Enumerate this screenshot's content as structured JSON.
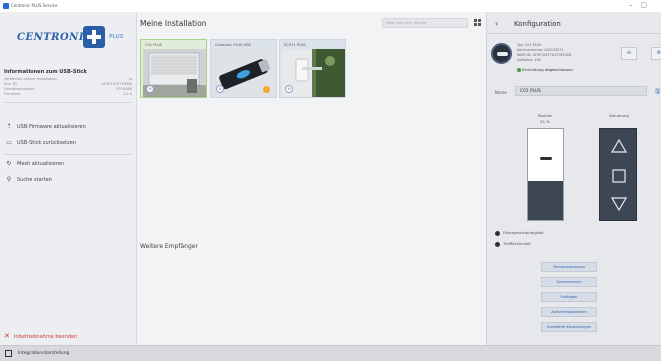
{
  "window": {
    "title": "Centronic PLUS Service"
  },
  "sidebar": {
    "logo": {
      "brand": "CENTRONIC",
      "plus_label": "PLUS"
    },
    "info_title": "Informationen zum USB-Stick",
    "info_rows": [
      {
        "label": "Verbindun aktiver Installation",
        "value": "ja"
      },
      {
        "label": "Anz. ID",
        "value": "4F0E7A1F7DEDA"
      },
      {
        "label": "Hardwareversion",
        "value": "070008B"
      },
      {
        "label": "Firmware",
        "value": "1.9.0"
      }
    ],
    "nav_items": [
      {
        "icon": "arrow-up-icon",
        "glyph": "⇡",
        "label": "USB-Firmware aktualisieren"
      },
      {
        "icon": "usb-stick-icon",
        "glyph": "▭",
        "label": "USB-Stick zurücksetzen"
      },
      {
        "icon": "refresh-icon",
        "glyph": "↻",
        "label": "Mesh aktualisieren"
      },
      {
        "icon": "search-icon",
        "glyph": "⚲",
        "label": "Suche starten"
      }
    ],
    "disable_label": "Inbetriebnahme beenden"
  },
  "main": {
    "title": "Meine Installation",
    "search_placeholder": "Filter nach Art / Kunde",
    "devices": [
      {
        "label": "C01 PLUS",
        "selected": true,
        "warning": false
      },
      {
        "label": "Centronic PLUS USB",
        "selected": false,
        "warning": true
      },
      {
        "label": "SC911 PLUS",
        "selected": false,
        "warning": false
      }
    ],
    "other_receivers_title": "Weitere Empfänger"
  },
  "config": {
    "title": "Konfiguration",
    "device_lines": [
      "Typ: C01 PLUS",
      "Seriennummer: 000123071",
      "WAPI-ID: 4F0E7A1F7D1F0E12E8",
      "Software: 108"
    ],
    "device_status": "Einrichtung abgeschlossen",
    "name_label": "Name",
    "name_value": "C01 PLUS",
    "position_label": "Position",
    "position_value": "51 %",
    "position_fraction": 0.43,
    "control_label": "Steuerung",
    "options": [
      "Fixiergeschwindigkeit",
      "Tiefflächenzeit"
    ],
    "actions": [
      "Sensorzuordnung",
      "Sonnenschutz",
      "Endlagen",
      "Zwischenpositionen",
      "Erweiterte Einstellungen"
    ]
  },
  "statusbar": {
    "label": "Integrationsdarstellung"
  },
  "colors": {
    "accent": "#2a5fa8",
    "selected_card": "#e2edd9",
    "ok_green": "#48a13c",
    "warn_orange": "#f6a623",
    "danger_red": "#d03a3a",
    "control_dark": "#3d4653"
  }
}
